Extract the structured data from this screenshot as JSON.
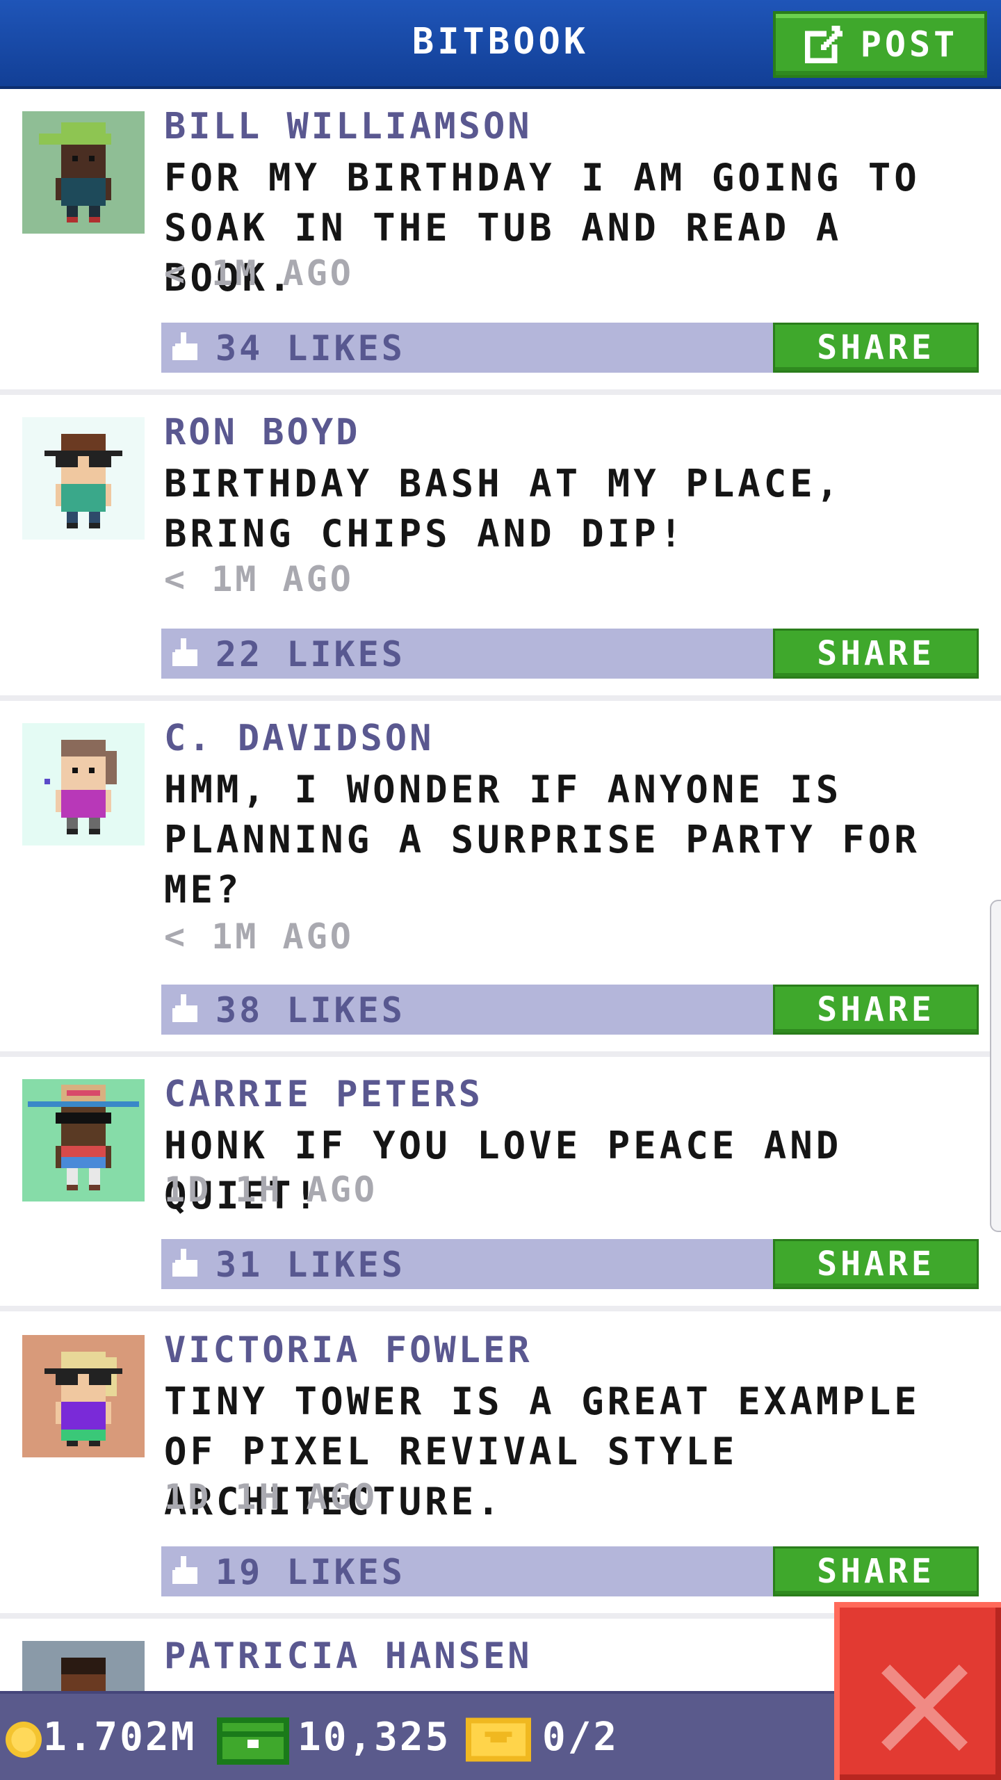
{
  "header": {
    "title": "BITBOOK",
    "post_label": "POST"
  },
  "posts": [
    {
      "author": "BILL WILLIAMSON",
      "message": "FOR MY BIRTHDAY I AM GOING TO SOAK IN THE TUB AND READ A BOOK.",
      "time": "< 1M AGO",
      "likes": "34 LIKES",
      "share_label": "SHARE"
    },
    {
      "author": "RON BOYD",
      "message": "BIRTHDAY BASH AT MY PLACE, BRING CHIPS AND DIP!",
      "time": "< 1M AGO",
      "likes": "22 LIKES",
      "share_label": "SHARE"
    },
    {
      "author": "C. DAVIDSON",
      "message": "HMM, I WONDER IF ANYONE IS PLANNING A SURPRISE PARTY FOR ME?",
      "time": "< 1M AGO",
      "likes": "38 LIKES",
      "share_label": "SHARE"
    },
    {
      "author": "CARRIE PETERS",
      "message": "HONK IF YOU LOVE PEACE AND QUIET!",
      "time": "1D 1H AGO",
      "likes": "31 LIKES",
      "share_label": "SHARE"
    },
    {
      "author": "VICTORIA FOWLER",
      "message": "TINY TOWER IS A GREAT EXAMPLE OF PIXEL REVIVAL STYLE ARCHITECTURE.",
      "time": "1D 1H AGO",
      "likes": "19 LIKES",
      "share_label": "SHARE"
    },
    {
      "author": "PATRICIA HANSEN"
    }
  ],
  "status_bar": {
    "coins": "1.702M",
    "bux": "10,325",
    "tickets": "0/2"
  },
  "icons": {
    "post": "edit-icon",
    "like": "thumbs-up-icon",
    "coins": "coin-icon",
    "bux": "bux-icon",
    "tickets": "ticket-icon",
    "close": "close-icon"
  },
  "colors": {
    "header": "#1f55b8",
    "button_green": "#3fa82c",
    "like_bar": "#b4b6da",
    "author_text": "#5a5890",
    "bottom_bar": "#5a5a8c",
    "close_red": "#e23a32"
  }
}
